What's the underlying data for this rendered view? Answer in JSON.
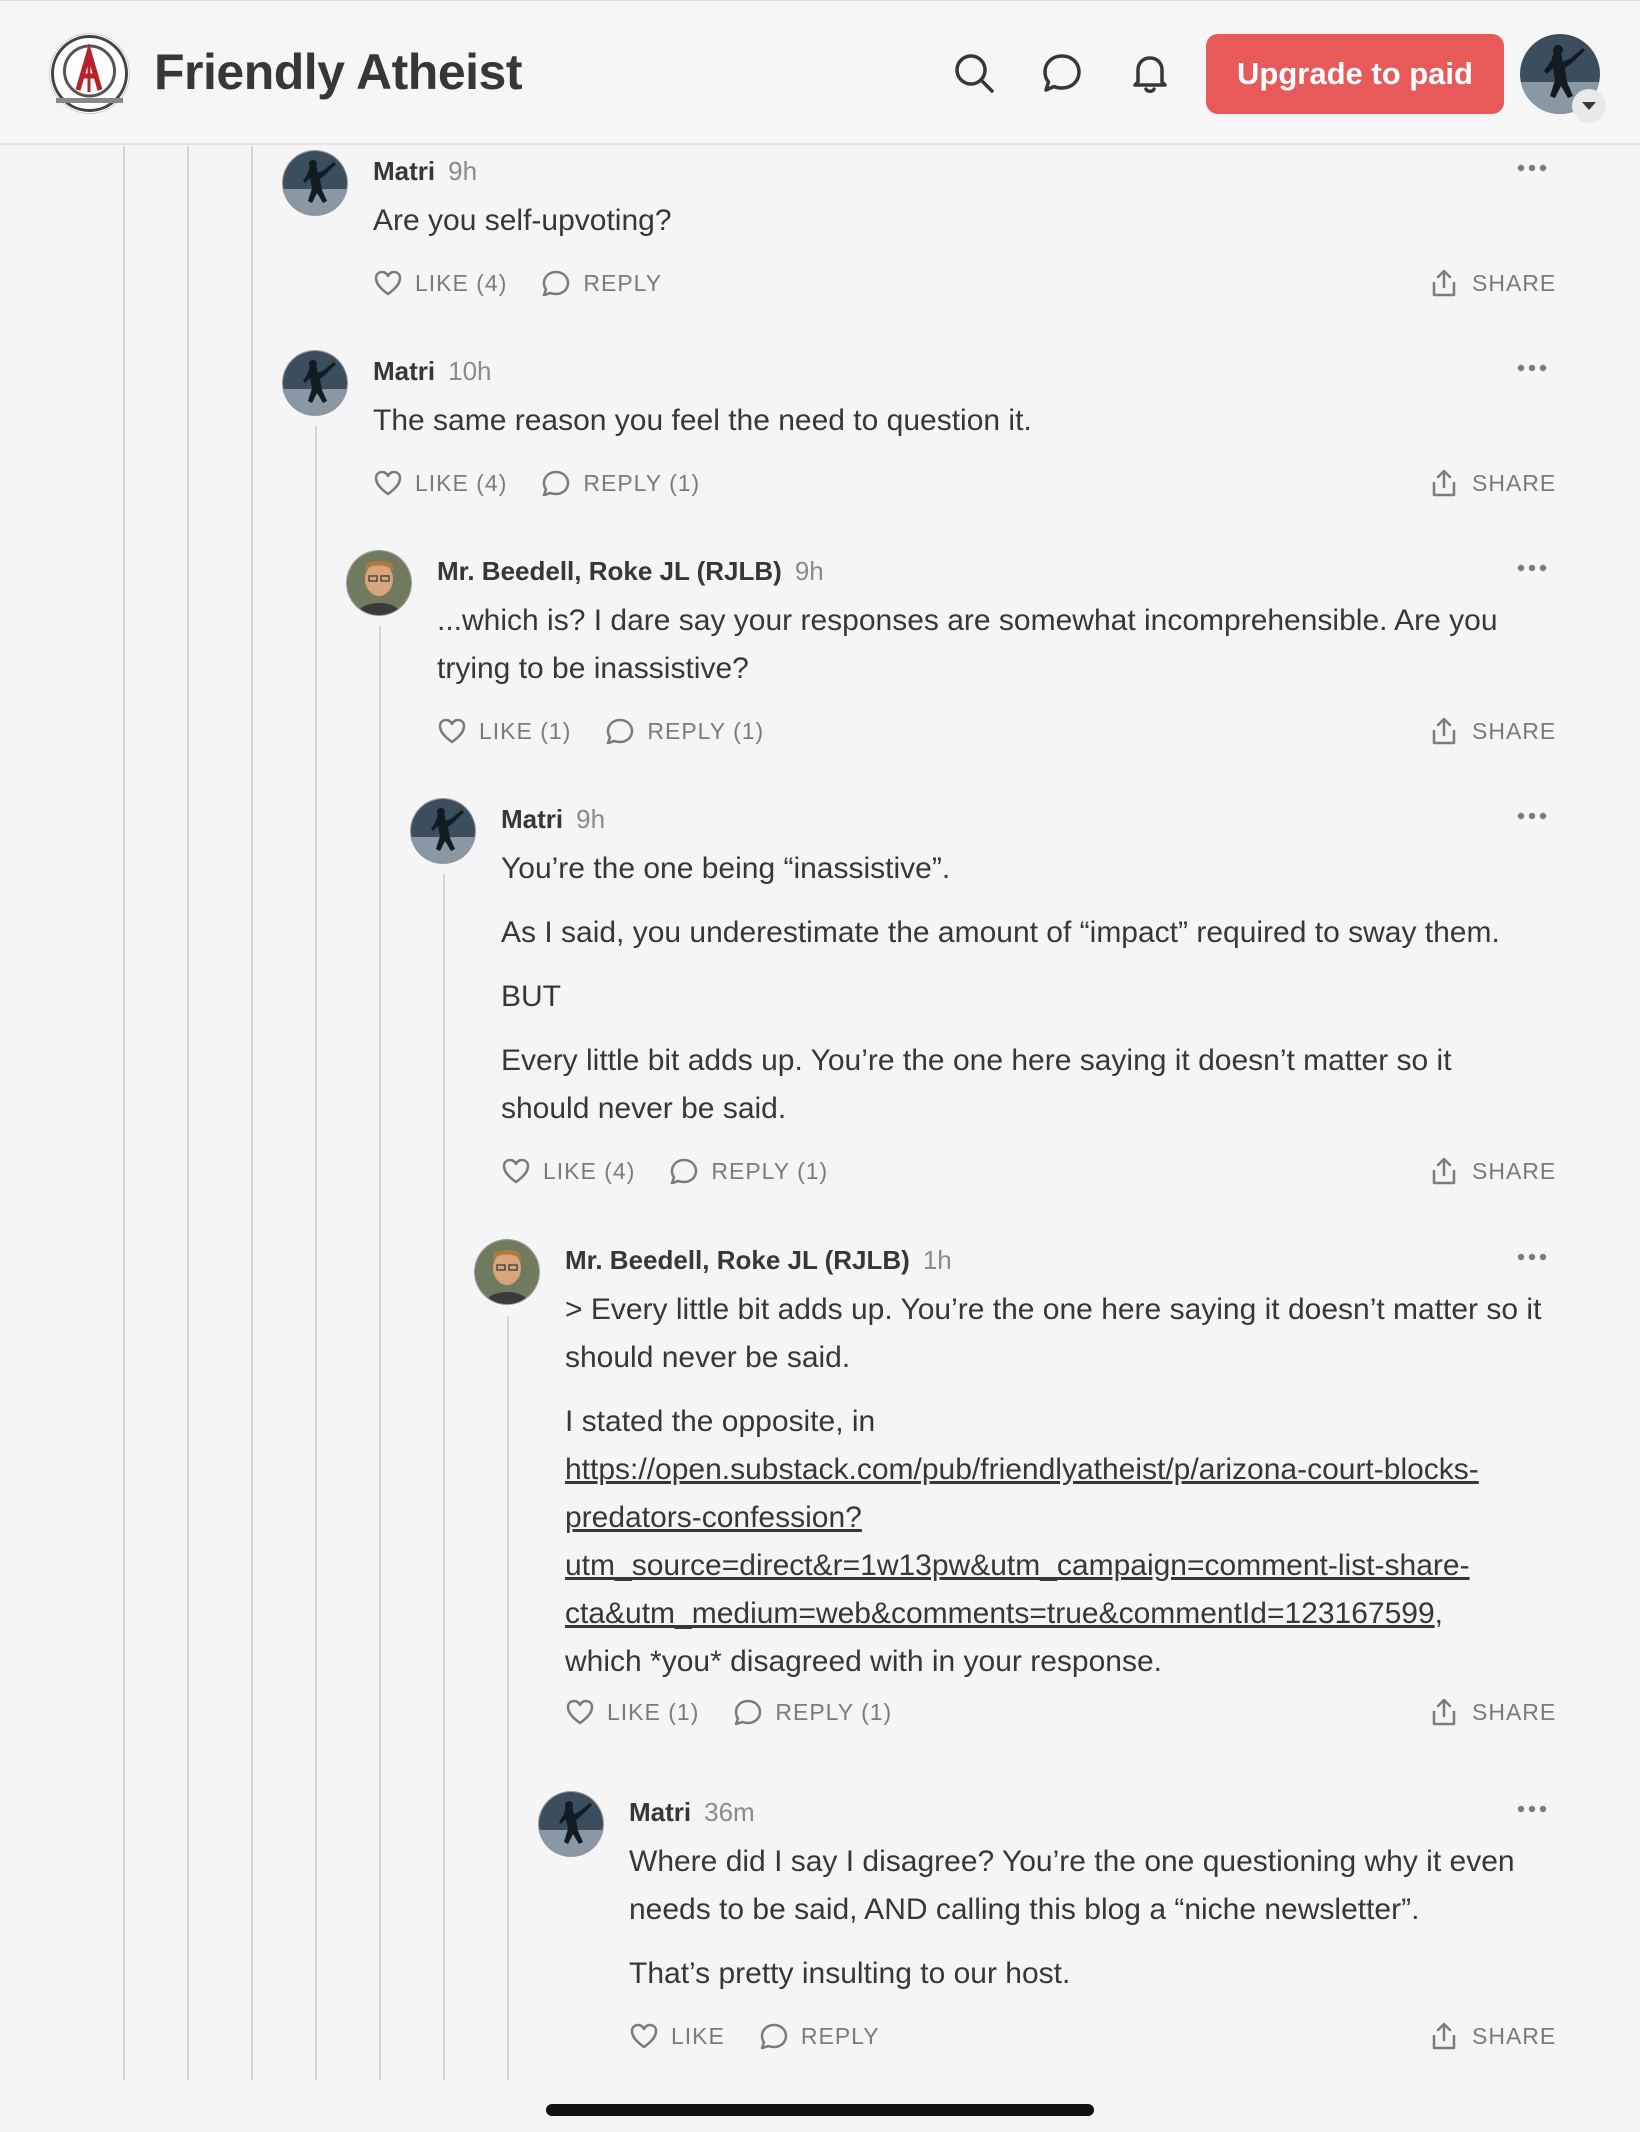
{
  "header": {
    "site_title": "Friendly Atheist",
    "upgrade_label": "Upgrade to paid",
    "icons": [
      "search-icon",
      "chat-icon",
      "bell-icon"
    ],
    "accent_color": "#e8595a"
  },
  "comments": [
    {
      "author": "Matri",
      "time": "9h",
      "paragraphs": [
        "Are you self-upvoting?"
      ],
      "like_label": "LIKE (4)",
      "reply_label": "REPLY",
      "share_label": "SHARE"
    },
    {
      "author": "Matri",
      "time": "10h",
      "paragraphs": [
        "The same reason you feel the need to question it."
      ],
      "like_label": "LIKE (4)",
      "reply_label": "REPLY (1)",
      "share_label": "SHARE"
    },
    {
      "author": "Mr. Beedell, Roke JL (RJLB)",
      "time": "9h",
      "paragraphs": [
        "...which is? I dare say your responses are somewhat incomprehensible. Are you trying to be inassistive?"
      ],
      "like_label": "LIKE (1)",
      "reply_label": "REPLY (1)",
      "share_label": "SHARE"
    },
    {
      "author": "Matri",
      "time": "9h",
      "paragraphs": [
        "You’re the one being “inassistive”.",
        "As I said, you underestimate the amount of “impact” required to sway them.",
        "BUT",
        "Every little bit adds up. You’re the one here saying it doesn’t matter so it should never be said."
      ],
      "like_label": "LIKE (4)",
      "reply_label": "REPLY (1)",
      "share_label": "SHARE"
    },
    {
      "author": "Mr. Beedell, Roke JL (RJLB)",
      "time": "1h",
      "paragraphs": [
        "> Every little bit adds up. You’re the one here saying it doesn’t matter so it should never be said."
      ],
      "link_intro": "I stated the opposite, in",
      "link_line1": "https://open.substack.com/pub/friendlyatheist/p/arizona-court-blocks-",
      "link_line2": "predators-confession?",
      "link_line3": "utm_source=direct&r=1w13pw&utm_campaign=comment-list-share-",
      "link_line4": "cta&utm_medium=web&comments=true&commentId=123167599",
      "link_outro": "which *you* disagreed with in your response.",
      "like_label": "LIKE (1)",
      "reply_label": "REPLY (1)",
      "share_label": "SHARE"
    },
    {
      "author": "Matri",
      "time": "36m",
      "paragraphs": [
        "Where did I say I disagree? You’re the one questioning why it even needs to be said, AND calling this blog a “niche newsletter”.",
        "That’s pretty insulting to our host."
      ],
      "like_label": "LIKE",
      "reply_label": "REPLY",
      "share_label": "SHARE"
    }
  ]
}
